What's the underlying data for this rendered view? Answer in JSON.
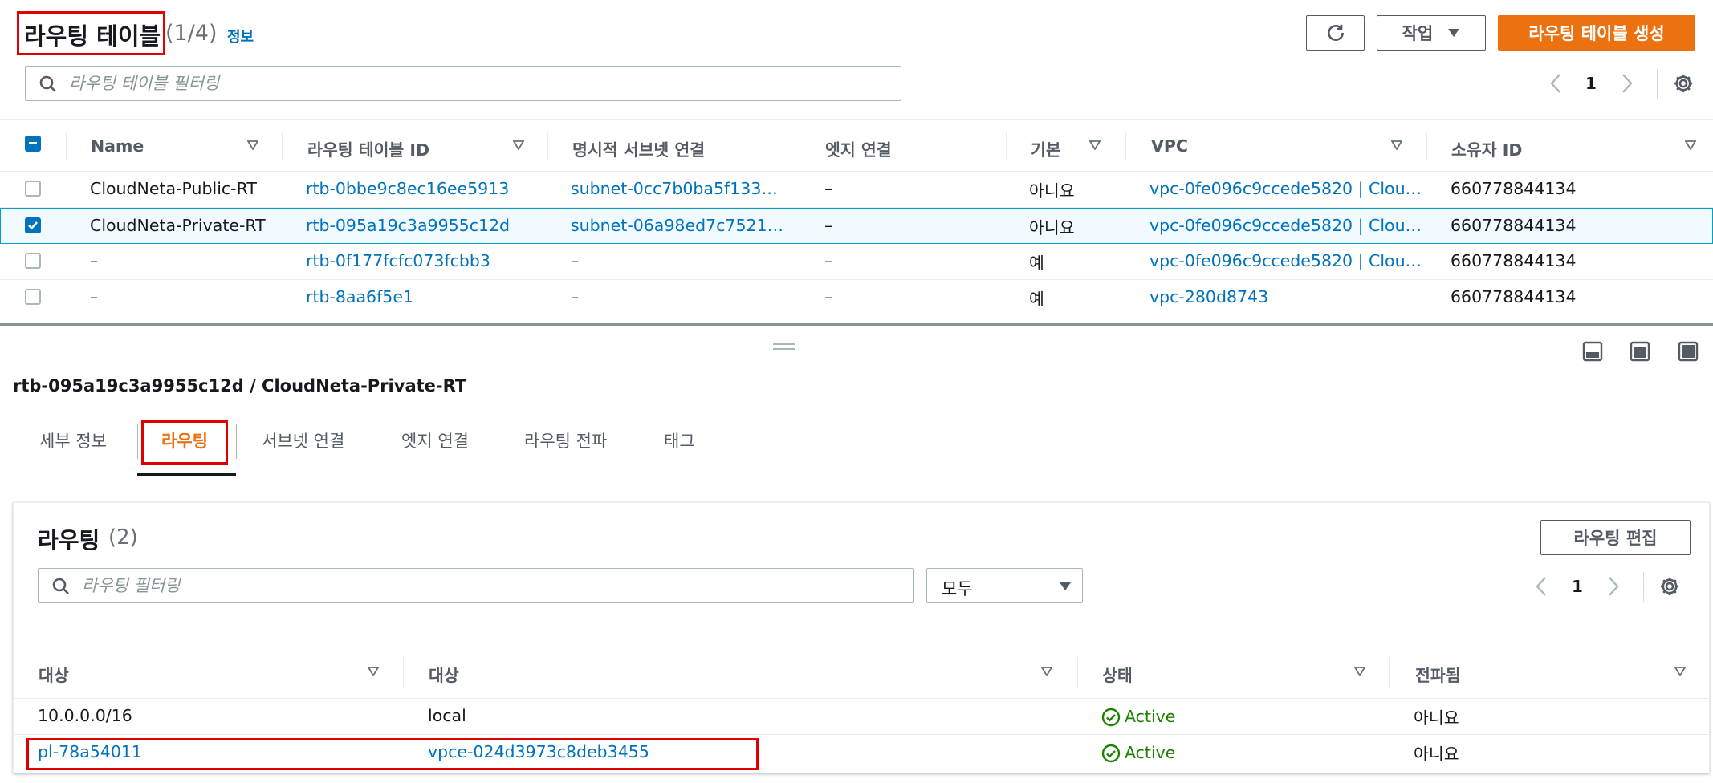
{
  "top_panel": {
    "title": "라우팅 테이블",
    "count": "(1/4)",
    "info_link": "정보",
    "actions_label": "작업",
    "create_label": "라우팅 테이블 생성",
    "filter_placeholder": "라우팅 테이블 필터링",
    "page": "1",
    "columns": [
      "Name",
      "라우팅 테이블 ID",
      "명시적 서브넷 연결",
      "엣지 연결",
      "기본",
      "VPC",
      "소유자 ID"
    ],
    "rows": [
      {
        "name": "CloudNeta-Public-RT",
        "id": "rtb-0bbe9c8ec16ee5913",
        "subnet": "subnet-0cc7b0ba5f133…",
        "edge": "–",
        "main": "아니요",
        "vpc": "vpc-0fe096c9ccede5820 | Clou…",
        "owner": "660778844134",
        "selected": false
      },
      {
        "name": "CloudNeta-Private-RT",
        "id": "rtb-095a19c3a9955c12d",
        "subnet": "subnet-06a98ed7c7521…",
        "edge": "–",
        "main": "아니요",
        "vpc": "vpc-0fe096c9ccede5820 | Clou…",
        "owner": "660778844134",
        "selected": true
      },
      {
        "name": "–",
        "id": "rtb-0f177fcfc073fcbb3",
        "subnet": "–",
        "edge": "–",
        "main": "예",
        "vpc": "vpc-0fe096c9ccede5820 | Clou…",
        "owner": "660778844134",
        "selected": false
      },
      {
        "name": "–",
        "id": "rtb-8aa6f5e1",
        "subnet": "–",
        "edge": "–",
        "main": "예",
        "vpc": "vpc-280d8743",
        "owner": "660778844134",
        "selected": false
      }
    ]
  },
  "detail": {
    "heading": "rtb-095a19c3a9955c12d / CloudNeta-Private-RT",
    "tabs": [
      "세부 정보",
      "라우팅",
      "서브넷 연결",
      "엣지 연결",
      "라우팅 전파",
      "태그"
    ],
    "active_tab": "라우팅",
    "routes_title": "라우팅",
    "routes_count": "(2)",
    "edit_label": "라우팅 편집",
    "filter_placeholder": "라우팅 필터링",
    "select_value": "모두",
    "page": "1",
    "columns": [
      "대상",
      "대상",
      "상태",
      "전파됨"
    ],
    "rows": [
      {
        "destination": "10.0.0.0/16",
        "target": "local",
        "status": "Active",
        "propagated": "아니요",
        "dest_link": false,
        "target_link": false
      },
      {
        "destination": "pl-78a54011",
        "target": "vpce-024d3973c8deb3455",
        "status": "Active",
        "propagated": "아니요",
        "dest_link": true,
        "target_link": true
      }
    ]
  },
  "colors": {
    "accent": "#ec7211",
    "link": "#0073bb",
    "success": "#1d8102",
    "highlight": "#e00000"
  }
}
